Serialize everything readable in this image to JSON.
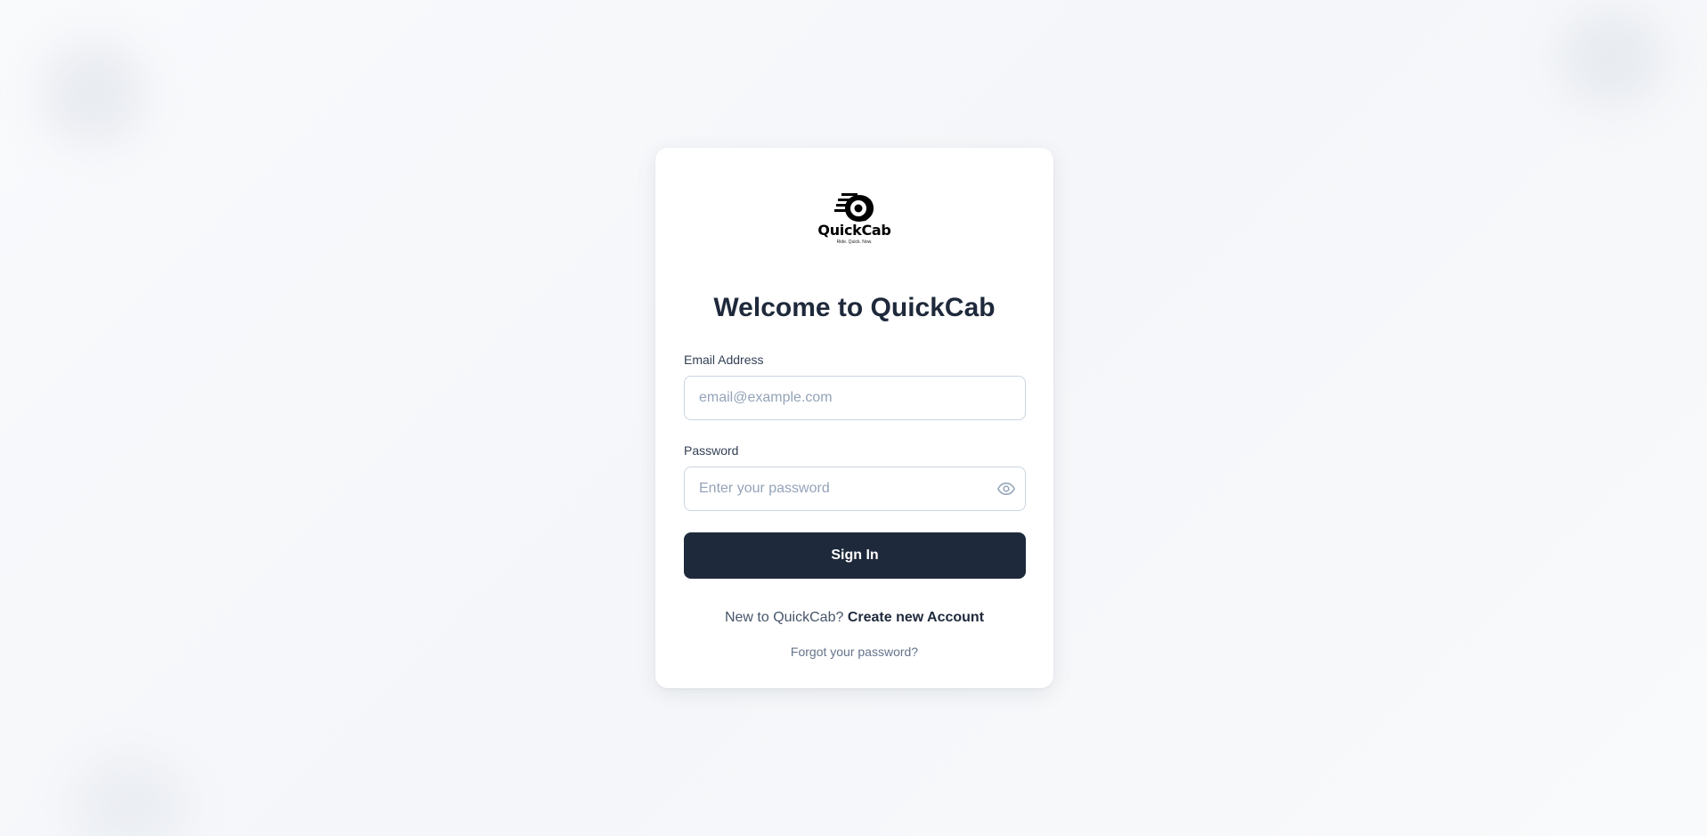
{
  "brand": {
    "name": "QuickCab",
    "tagline": "Ride. Quick. Now."
  },
  "login": {
    "title": "Welcome to QuickCab",
    "email_label": "Email Address",
    "email_placeholder": "email@example.com",
    "email_value": "",
    "password_label": "Password",
    "password_placeholder": "Enter your password",
    "password_value": "",
    "show_password_icon": "eye-icon",
    "submit_label": "Sign In",
    "signup_prompt": "New to QuickCab?",
    "signup_link": "Create new Account",
    "forgot_link": "Forgot your password?"
  },
  "colors": {
    "primary": "#1e293b",
    "card_background": "#ffffff",
    "page_background": "#f8f9fb",
    "input_border": "#cbd5e1",
    "placeholder": "#94a3b8"
  }
}
